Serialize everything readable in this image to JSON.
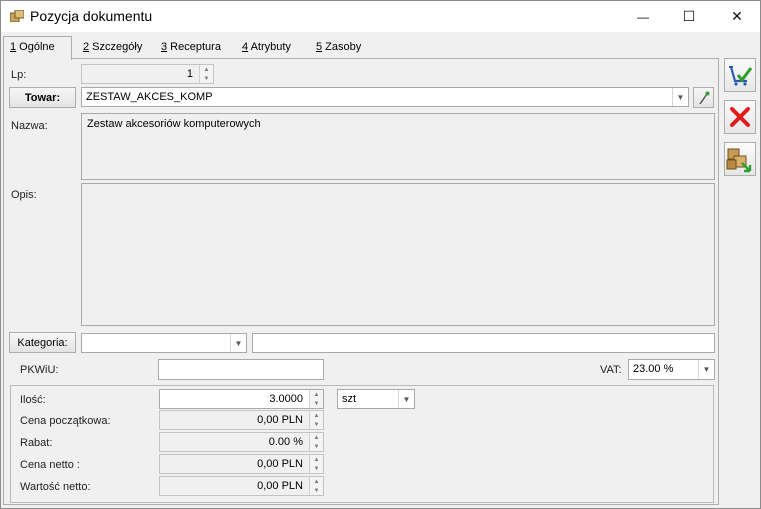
{
  "window": {
    "title": "Pozycja dokumentu",
    "minimize_glyph": "—",
    "maximize_glyph": "☐",
    "close_glyph": "✕"
  },
  "tabs": [
    {
      "key": "1",
      "label": " Ogólne"
    },
    {
      "key": "2",
      "label": " Szczegóły"
    },
    {
      "key": "3",
      "label": " Receptura"
    },
    {
      "key": "4",
      "label": " Atrybuty"
    },
    {
      "key": "5",
      "label": " Zasoby"
    }
  ],
  "form": {
    "lp_label": "Lp:",
    "lp_value": "1",
    "towar_button": "Towar:",
    "towar_value": "ZESTAW_AKCES_KOMP",
    "nazwa_label": "Nazwa:",
    "nazwa_value": "Zestaw akcesoriów komputerowych",
    "opis_label": "Opis:",
    "opis_value": "",
    "kategoria_button": "Kategoria:",
    "kategoria_value": "",
    "kategoria_desc": "",
    "pkwiu_label": "PKWiU:",
    "pkwiu_value": "",
    "vat_label": "VAT:",
    "vat_value": "23.00 %",
    "ilosc_label": "Ilość:",
    "ilosc_value": "3.0000",
    "unit_value": "szt",
    "cena_pocz_label": "Cena początkowa:",
    "cena_pocz_value": "0,00 PLN",
    "rabat_label": "Rabat:",
    "rabat_value": "0.00 %",
    "cena_netto_label": "Cena netto :",
    "cena_netto_value": "0,00 PLN",
    "wartosc_netto_label": "Wartość netto:",
    "wartosc_netto_value": "0,00 PLN"
  },
  "side_buttons": [
    {
      "icon": "save-check-icon"
    },
    {
      "icon": "cancel-x-icon"
    },
    {
      "icon": "boxes-arrow-icon"
    }
  ]
}
